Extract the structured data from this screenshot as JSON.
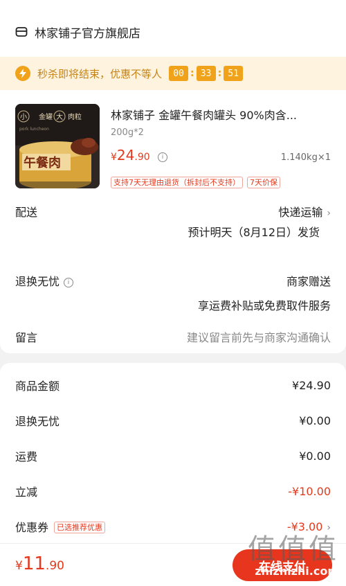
{
  "shop": {
    "name": "林家铺子官方旗舰店",
    "icon": "store-icon"
  },
  "flash_sale": {
    "text": "秒杀即将结束，优惠不等人",
    "countdown": [
      "00",
      "33",
      "51"
    ],
    "accent": "#f0a21a"
  },
  "product": {
    "title": "林家铺子 金罐午餐肉罐头 90%肉含...",
    "spec": "200g*2",
    "price_currency": "¥",
    "price_int": "24",
    "price_dec": ".90",
    "weight_qty": "1.140kg×1",
    "tags": [
      "支持7天无理由退货（拆封后不支持）",
      "7天价保"
    ],
    "image": {
      "small_text_1": "小",
      "can_text": "金罐",
      "big": "大",
      "meat": "肉粒",
      "brand_line": "午餐肉",
      "sub_line": "pork luncheon"
    }
  },
  "delivery": {
    "label": "配送",
    "method": "快递运输",
    "eta": "预计明天（8月12日）发货"
  },
  "returns": {
    "label": "退换无忧",
    "value": "商家赠送",
    "desc": "享运费补贴或免费取件服务"
  },
  "message": {
    "label": "留言",
    "placeholder": "建议留言前先与商家沟通确认"
  },
  "summary": {
    "goods_label": "商品金额",
    "goods_value": "¥24.90",
    "returns_label": "退换无忧",
    "returns_value": "¥0.00",
    "shipping_label": "运费",
    "shipping_value": "¥0.00",
    "discount_label": "立减",
    "discount_value": "-¥10.00",
    "coupon_label": "优惠券",
    "coupon_tag": "已选推荐优惠",
    "coupon_value": "-¥3.00"
  },
  "bottom": {
    "total_currency": "¥",
    "total_int": "11",
    "total_dec": ".90",
    "pay_label": "在线支付"
  },
  "watermark": {
    "glyphs": "值值值",
    "url": "zhizhizhi.com"
  },
  "colors": {
    "price_red": "#e5391e",
    "pay_button": "#e8361e"
  }
}
